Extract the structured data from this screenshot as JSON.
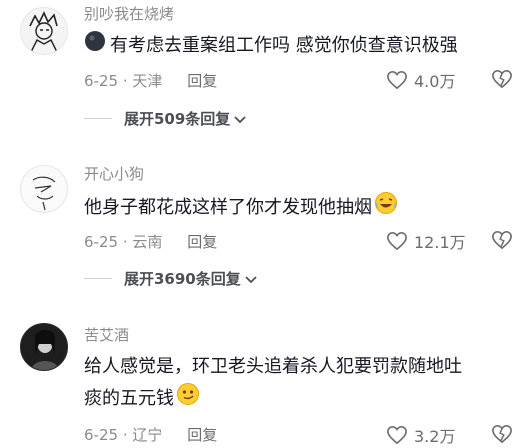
{
  "comments": [
    {
      "username": "别吵我在烧烤",
      "text": "有考虑去重案组工作吗 感觉你侦查意识极强",
      "date": "6-25",
      "location": "天津",
      "reply_label": "回复",
      "likes": "4.0万",
      "expand_label": "展开509条回复",
      "lead_emoji_icon": "dark-blob-emoji",
      "avatar_icon": "anime-sketch-avatar"
    },
    {
      "username": "开心小狗",
      "text": "他身子都花成这样了你才发现他抽烟",
      "date": "6-25",
      "location": "云南",
      "reply_label": "回复",
      "likes": "12.1万",
      "expand_label": "展开3690条回复",
      "trail_emoji_icon": "laugh-cry-emoji",
      "avatar_icon": "line-drawing-avatar"
    },
    {
      "username": "苦艾酒",
      "text_line1": "给人感觉是，环卫老头追着杀人犯要罚款随地吐",
      "text_line2": "痰的五元钱",
      "date": "6-25",
      "location": "辽宁",
      "reply_label": "回复",
      "likes": "3.2万",
      "trail_emoji_icon": "smirk-emoji",
      "avatar_icon": "dark-portrait-avatar"
    }
  ],
  "meta_separator": "·",
  "icons": {
    "heart": "heart-outline-icon",
    "dislike": "broken-heart-icon",
    "chevron": "chevron-down-icon"
  }
}
